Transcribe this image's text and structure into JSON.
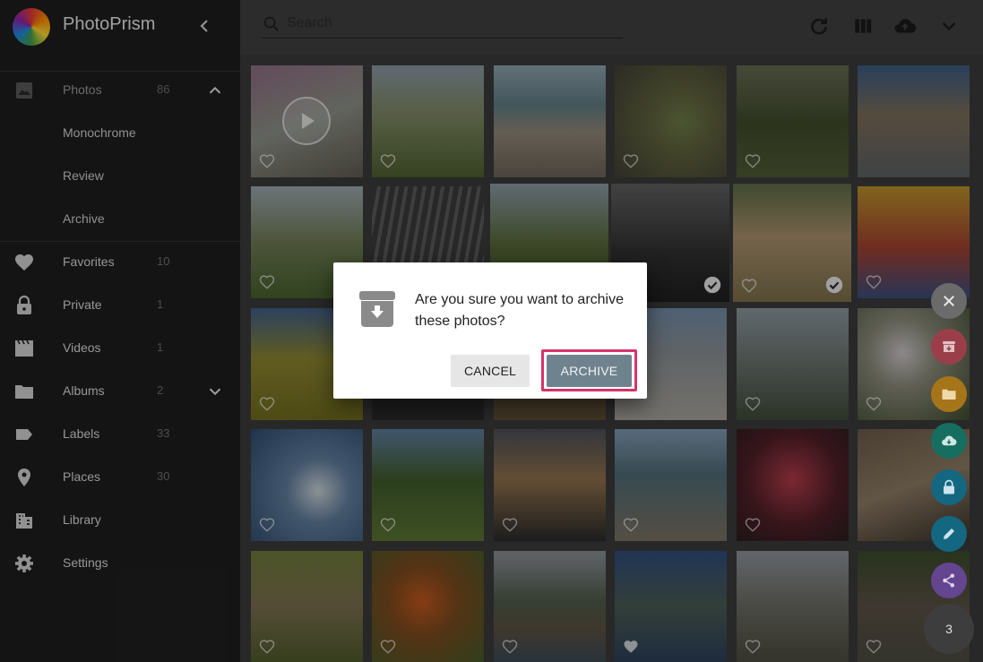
{
  "app": {
    "title": "PhotoPrism"
  },
  "sidebar": {
    "items": [
      {
        "label": "Photos",
        "count": "86",
        "icon": "photo-icon"
      },
      {
        "label": "Monochrome",
        "count": ""
      },
      {
        "label": "Review",
        "count": ""
      },
      {
        "label": "Archive",
        "count": ""
      },
      {
        "label": "Favorites",
        "count": "10",
        "icon": "heart-icon"
      },
      {
        "label": "Private",
        "count": "1",
        "icon": "lock-icon"
      },
      {
        "label": "Videos",
        "count": "1",
        "icon": "movie-icon"
      },
      {
        "label": "Albums",
        "count": "2",
        "icon": "folder-icon"
      },
      {
        "label": "Labels",
        "count": "33",
        "icon": "label-icon"
      },
      {
        "label": "Places",
        "count": "30",
        "icon": "place-icon"
      },
      {
        "label": "Library",
        "count": "",
        "icon": "library-icon"
      },
      {
        "label": "Settings",
        "count": "",
        "icon": "settings-icon"
      }
    ]
  },
  "toolbar": {
    "search_placeholder": "Search"
  },
  "dialog": {
    "message": "Are you sure you want to archive these photos?",
    "cancel_label": "CANCEL",
    "confirm_label": "ARCHIVE"
  },
  "selection": {
    "count": "3"
  },
  "colors": {
    "accent_highlight": "#d6336c",
    "archive_button": "#6f838f",
    "fab_archive": "#d85b6b",
    "fab_album": "#e6a321",
    "fab_download": "#1f9a86",
    "fab_private": "#1c8fb0",
    "fab_edit": "#1c8fb0",
    "fab_share": "#8a5fc4"
  }
}
